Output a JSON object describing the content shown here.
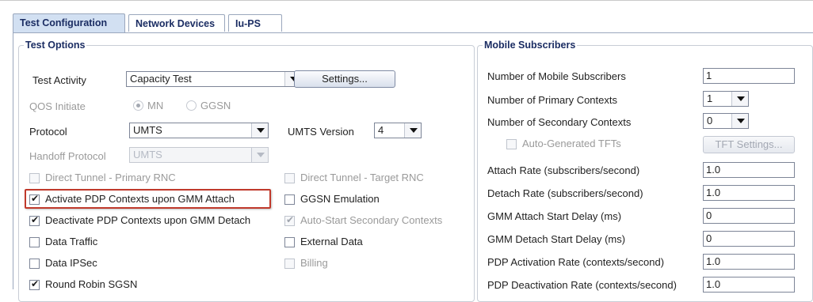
{
  "tabs": [
    "Test Configuration",
    "Network Devices",
    "Iu-PS"
  ],
  "test_options": {
    "legend": "Test Options",
    "test_activity_label": "Test Activity",
    "test_activity_value": "Capacity Test",
    "settings_button": "Settings...",
    "qos_initiate_label": "QOS Initiate",
    "qos_mn": "MN",
    "qos_ggsn": "GGSN",
    "protocol_label": "Protocol",
    "protocol_value": "UMTS",
    "umts_version_label": "UMTS Version",
    "umts_version_value": "4",
    "handoff_protocol_label": "Handoff Protocol",
    "handoff_protocol_value": "UMTS",
    "checkboxes_left": [
      {
        "label": "Direct Tunnel - Primary RNC",
        "checked": false,
        "enabled": false
      },
      {
        "label": "Activate PDP Contexts upon GMM Attach",
        "checked": true,
        "enabled": true
      },
      {
        "label": "Deactivate PDP Contexts upon GMM Detach",
        "checked": true,
        "enabled": true
      },
      {
        "label": "Data Traffic",
        "checked": false,
        "enabled": true
      },
      {
        "label": "Data IPSec",
        "checked": false,
        "enabled": true
      },
      {
        "label": "Round Robin SGSN",
        "checked": true,
        "enabled": true
      }
    ],
    "checkboxes_right": [
      {
        "label": "Direct Tunnel - Target RNC",
        "checked": false,
        "enabled": false
      },
      {
        "label": "GGSN Emulation",
        "checked": false,
        "enabled": true
      },
      {
        "label": "Auto-Start Secondary Contexts",
        "checked": true,
        "enabled": false
      },
      {
        "label": "External Data",
        "checked": false,
        "enabled": true
      },
      {
        "label": "Billing",
        "checked": false,
        "enabled": false
      }
    ]
  },
  "mobile_subscribers": {
    "legend": "Mobile Subscribers",
    "num_subscribers_label": "Number of Mobile Subscribers",
    "num_subscribers_value": "1",
    "primary_contexts_label": "Number of Primary Contexts",
    "primary_contexts_value": "1",
    "secondary_contexts_label": "Number of Secondary Contexts",
    "secondary_contexts_value": "0",
    "auto_tfts_label": "Auto-Generated TFTs",
    "tft_settings_button": "TFT Settings...",
    "attach_rate_label": "Attach Rate (subscribers/second)",
    "attach_rate_value": "1.0",
    "detach_rate_label": "Detach Rate (subscribers/second)",
    "detach_rate_value": "1.0",
    "gmm_attach_delay_label": "GMM Attach Start Delay (ms)",
    "gmm_attach_delay_value": "0",
    "gmm_detach_delay_label": "GMM Detach Start Delay (ms)",
    "gmm_detach_delay_value": "0",
    "pdp_activation_label": "PDP Activation Rate (contexts/second)",
    "pdp_activation_value": "1.0",
    "pdp_deactivation_label": "PDP Deactivation Rate (contexts/second)",
    "pdp_deactivation_value": "1.0"
  },
  "colors": {
    "tab_active_bg": "#d2e0f2",
    "tab_text": "#1b2d63",
    "highlight_border": "#c0392b",
    "disabled_text": "#9a9a9a"
  }
}
